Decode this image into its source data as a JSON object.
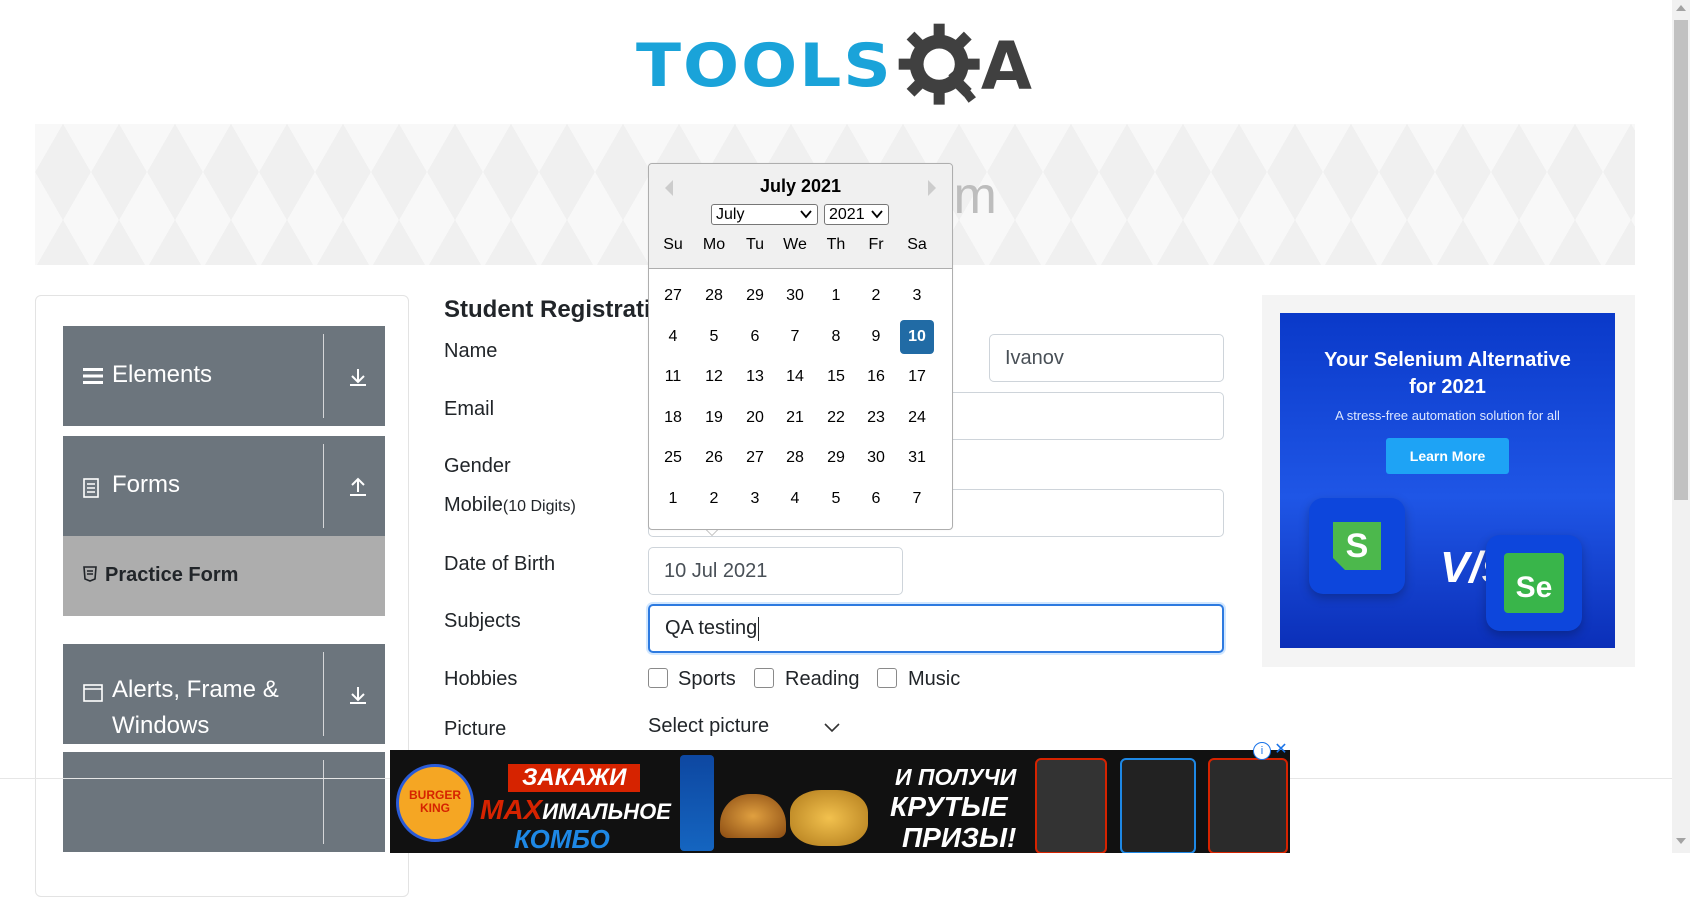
{
  "header": {
    "logo_text": "TOOLS",
    "logo_suffix": "A"
  },
  "banner": {
    "title": "Practice Form"
  },
  "sidebar": {
    "groups": [
      {
        "label": "Elements",
        "icon": "hamburger-icon",
        "arrow": "download-icon"
      },
      {
        "label": "Forms",
        "icon": "document-icon",
        "arrow": "upload-icon"
      },
      {
        "label": "Alerts, Frame &",
        "label2": "Windows",
        "icon": "window-icon",
        "arrow": "download-icon"
      }
    ],
    "active_item": {
      "label": "Practice Form",
      "icon": "html5-icon"
    }
  },
  "form": {
    "title": "Student Registration Form",
    "labels": {
      "name": "Name",
      "email": "Email",
      "gender": "Gender",
      "mobile": "Mobile",
      "mobile_hint": "(10 Digits)",
      "dob": "Date of Birth",
      "subjects": "Subjects",
      "hobbies": "Hobbies",
      "picture": "Picture"
    },
    "last_name_value": "Ivanov",
    "dob_value": "10 Jul 2021",
    "subjects_value": "QA testing",
    "hobbies": [
      "Sports",
      "Reading",
      "Music"
    ],
    "picture_placeholder": "Select picture"
  },
  "datepicker": {
    "header": "July 2021",
    "month_select": "July",
    "year_select": "2021",
    "day_names": [
      "Su",
      "Mo",
      "Tu",
      "We",
      "Th",
      "Fr",
      "Sa"
    ],
    "weeks": [
      [
        "27",
        "28",
        "29",
        "30",
        "1",
        "2",
        "3"
      ],
      [
        "4",
        "5",
        "6",
        "7",
        "8",
        "9",
        "10"
      ],
      [
        "11",
        "12",
        "13",
        "14",
        "15",
        "16",
        "17"
      ],
      [
        "18",
        "19",
        "20",
        "21",
        "22",
        "23",
        "24"
      ],
      [
        "25",
        "26",
        "27",
        "28",
        "29",
        "30",
        "31"
      ],
      [
        "1",
        "2",
        "3",
        "4",
        "5",
        "6",
        "7"
      ]
    ],
    "selected_day": "10"
  },
  "side_ad": {
    "headline1": "Your Selenium Alternative",
    "headline2": "for 2021",
    "subline": "A stress-free automation solution for all",
    "button": "Learn More",
    "vs": "V/s",
    "tile_left": "S",
    "tile_right": "Se"
  },
  "bottom_ad": {
    "brand": "BURGER KING",
    "text1": "ЗАКАЖИ",
    "text2a": "MAX",
    "text2b": "ИМАЛЬНОЕ",
    "text3": "КОМБО",
    "text4": "И ПОЛУЧИ",
    "text5": "КРУТЫЕ",
    "text6": "ПРИЗЫ!",
    "info": "i",
    "close": "✕"
  },
  "colors": {
    "brand_blue": "#1aa3d9",
    "sidebar_gray": "#6c757d",
    "selected_day": "#216ba5",
    "focus_border": "#2d7ae0"
  }
}
